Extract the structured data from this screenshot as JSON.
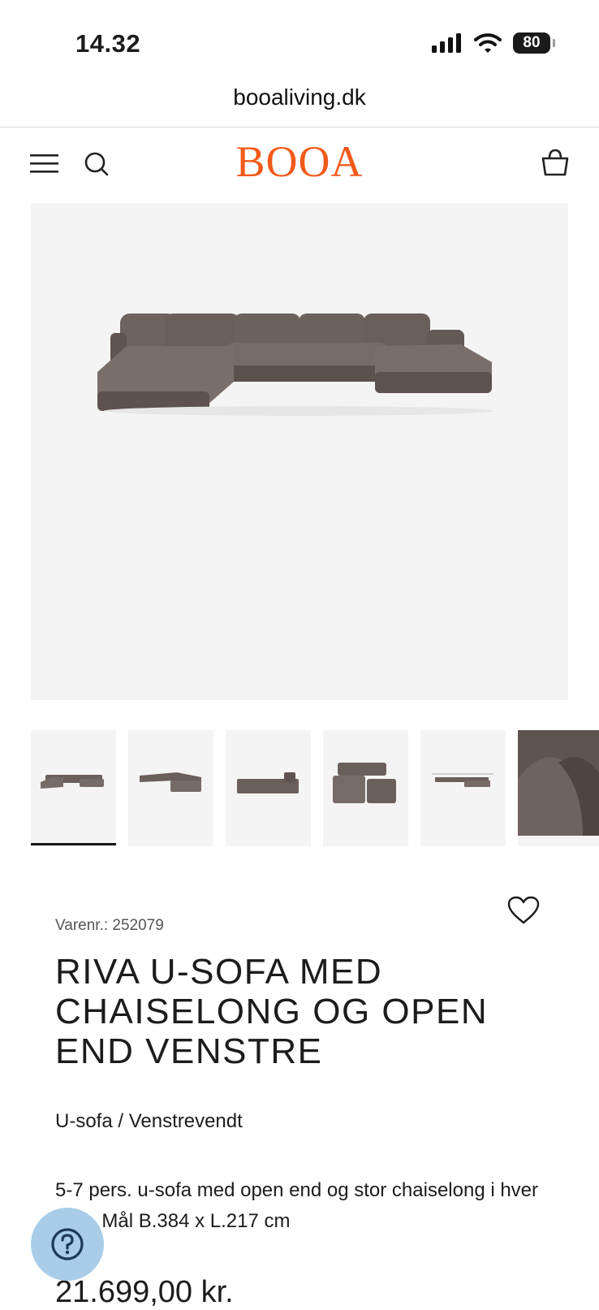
{
  "status_bar": {
    "time": "14.32",
    "battery": "80"
  },
  "browser": {
    "url": "booaliving.dk"
  },
  "header": {
    "logo": "BOOA"
  },
  "gallery": {
    "thumbnails": [
      "front view",
      "angled view",
      "side view",
      "perspective view",
      "dimensions view",
      "fabric closeup"
    ],
    "active_index": 0
  },
  "product": {
    "sku": "Varenr.: 252079",
    "title": "RIVA U-SOFA MED CHAISELONG OG OPEN END VENSTRE",
    "subtitle": "U-sofa / Venstrevendt",
    "description": "5-7 pers. u-sofa med open end og stor chaiselong i hver side. Mål B.384 x L.217 cm",
    "price": "21.699,00 kr."
  },
  "colors": {
    "brand": "#f25a1b",
    "sofa": "#6b5f5c",
    "help_bubble": "#a9cde8"
  }
}
